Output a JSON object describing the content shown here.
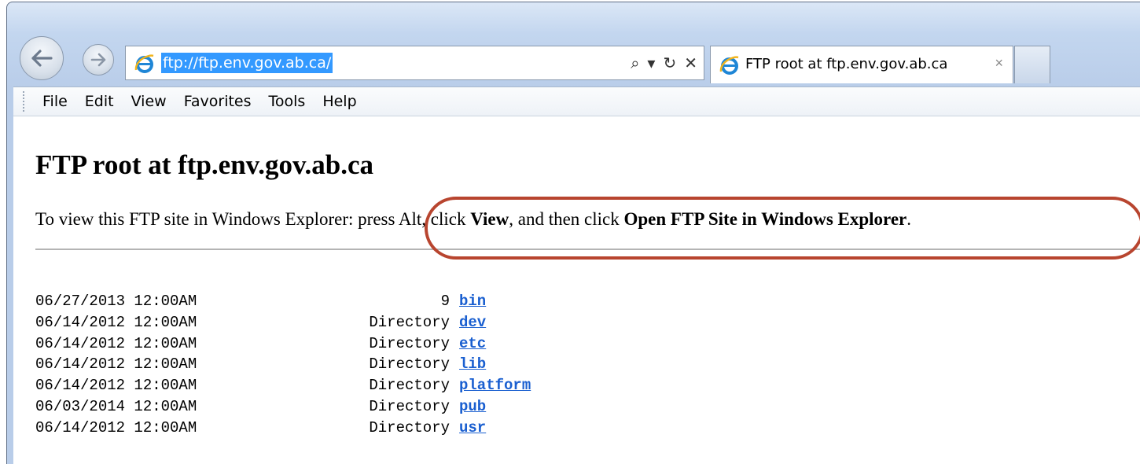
{
  "browser": {
    "url": "ftp://ftp.env.gov.ab.ca/",
    "tab_title": "FTP root at ftp.env.gov.ab.ca",
    "tab_close": "×",
    "address_tools": {
      "search": "⌕",
      "dropdown": "▾",
      "refresh": "↻",
      "stop": "✕"
    }
  },
  "menu": {
    "items": [
      "File",
      "Edit",
      "View",
      "Favorites",
      "Tools",
      "Help"
    ]
  },
  "page": {
    "heading": "FTP root at ftp.env.gov.ab.ca",
    "instructions": {
      "prefix": "To view this FTP site in Windows Explorer: press Alt, click ",
      "view_bold": "View",
      "middle": ", and then click ",
      "open_bold": "Open FTP Site in Windows Explorer",
      "suffix": "."
    },
    "listing": [
      {
        "date": "06/27/2013 12:00AM",
        "size": "9",
        "name": "bin"
      },
      {
        "date": "06/14/2012 12:00AM",
        "size": "Directory",
        "name": "dev"
      },
      {
        "date": "06/14/2012 12:00AM",
        "size": "Directory",
        "name": "etc"
      },
      {
        "date": "06/14/2012 12:00AM",
        "size": "Directory",
        "name": "lib"
      },
      {
        "date": "06/14/2012 12:00AM",
        "size": "Directory",
        "name": "platform"
      },
      {
        "date": "06/03/2014 12:00AM",
        "size": "Directory",
        "name": "pub"
      },
      {
        "date": "06/14/2012 12:00AM",
        "size": "Directory",
        "name": "usr"
      }
    ]
  },
  "colors": {
    "annotation": "#b8452f",
    "link": "#1a5fd0",
    "selection": "#3399ff"
  }
}
